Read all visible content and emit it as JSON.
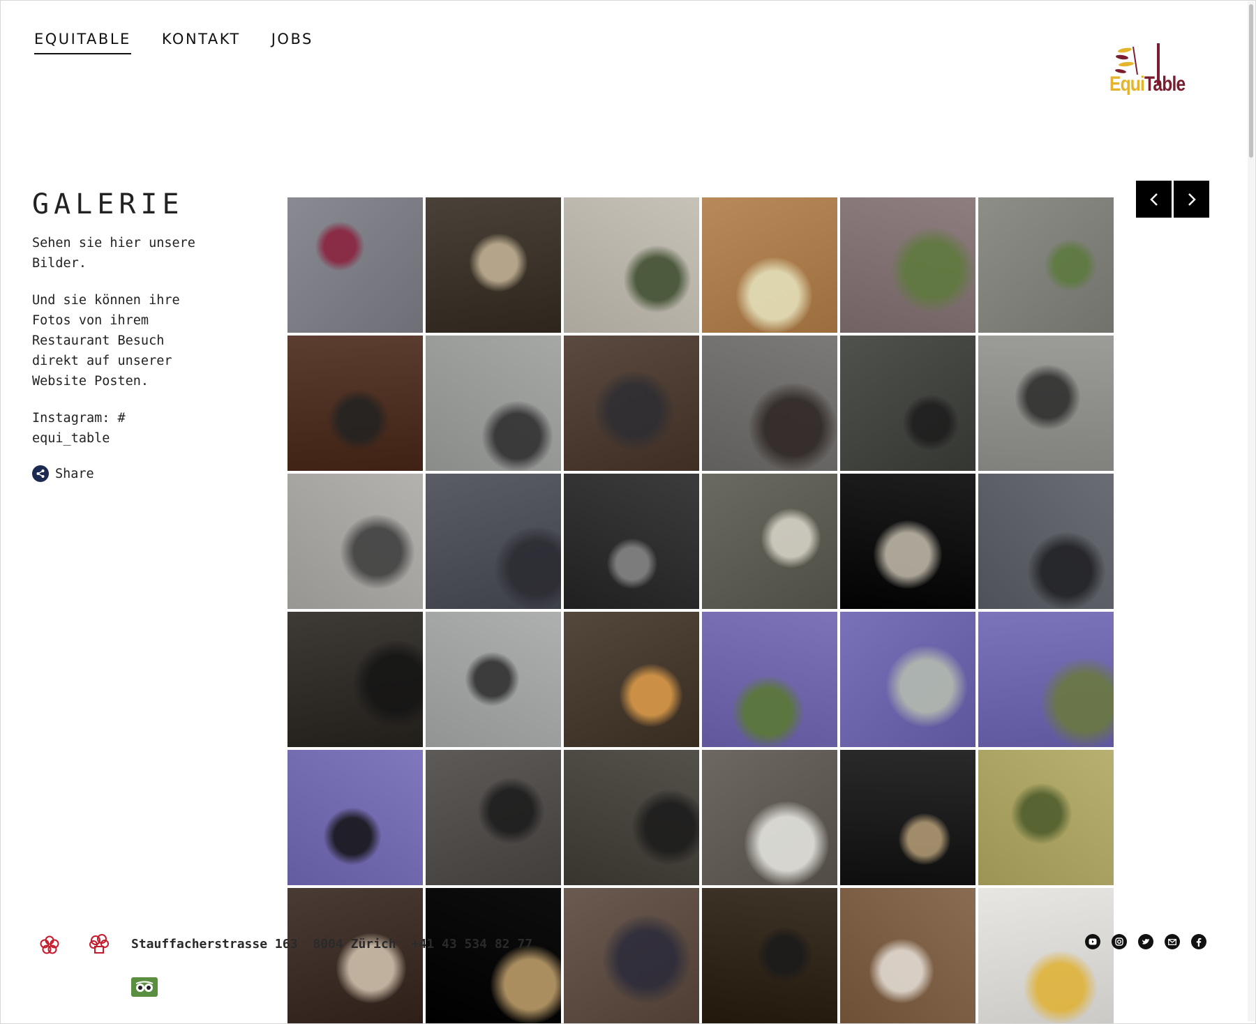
{
  "nav": {
    "items": [
      {
        "label": "EQUITABLE",
        "active": true
      },
      {
        "label": "KONTAKT",
        "active": false
      },
      {
        "label": "JOBS",
        "active": false
      }
    ]
  },
  "logo": {
    "part1": "Equi",
    "part2": "Table"
  },
  "galerie": {
    "title": "GALERIE",
    "intro": "Sehen sie hier unsere\nBilder.",
    "body": "Und sie können ihre\nFotos von ihrem\nRestaurant Besuch\ndirekt auf unserer\nWebsite Posten.",
    "instagram": "Instagram: #\nequi_table",
    "share_label": "Share"
  },
  "gallery": {
    "photos": [
      {
        "name": "photo-gault-millau-award",
        "bg": "#8a8a92",
        "accent": "#8b1d3a"
      },
      {
        "name": "photo-dining-room",
        "bg": "#4a4238",
        "accent": "#c9b89a"
      },
      {
        "name": "photo-dish-on-paper",
        "bg": "#c7c2b8",
        "accent": "#3a4a2a"
      },
      {
        "name": "photo-plate-on-wood",
        "bg": "#b88a5a",
        "accent": "#e8e6c0"
      },
      {
        "name": "photo-terrace-facade",
        "bg": "#8e7e80",
        "accent": "#5d7a3a"
      },
      {
        "name": "photo-entrance-plants",
        "bg": "#8d8e88",
        "accent": "#5c7a3c"
      },
      {
        "name": "photo-couple-at-bar",
        "bg": "#5c3e30",
        "accent": "#222"
      },
      {
        "name": "photo-couple-street",
        "bg": "#a6a8a6",
        "accent": "#2a2a2a"
      },
      {
        "name": "photo-chef-cutting",
        "bg": "#5a4a40",
        "accent": "#2d2d33"
      },
      {
        "name": "photo-chef-woman-kitchen",
        "bg": "#7c7a78",
        "accent": "#2c2422"
      },
      {
        "name": "photo-smiling-chef",
        "bg": "#50524e",
        "accent": "#1c1c1c"
      },
      {
        "name": "photo-chefs-in-kitchen",
        "bg": "#9c9c98",
        "accent": "#2a2a2a"
      },
      {
        "name": "photo-sneakers-apron",
        "bg": "#b4b2ae",
        "accent": "#3a3a3a"
      },
      {
        "name": "photo-chefs-group-closeup",
        "bg": "#5a5c66",
        "accent": "#2a2a30"
      },
      {
        "name": "photo-kitchen-line",
        "bg": "#3c3c3c",
        "accent": "#8a8a8a"
      },
      {
        "name": "photo-plating-siphon",
        "bg": "#6a6a60",
        "accent": "#dcd8cc"
      },
      {
        "name": "photo-dish-dark-plate",
        "bg": "#1e1e1e",
        "accent": "#c8c0b0"
      },
      {
        "name": "photo-team-portrait",
        "bg": "#6a6e74",
        "accent": "#1e1e22"
      },
      {
        "name": "photo-chef-hair-bun",
        "bg": "#3e3a36",
        "accent": "#141414"
      },
      {
        "name": "photo-chef-and-guest",
        "bg": "#aeb0b0",
        "accent": "#2a2a2a"
      },
      {
        "name": "photo-grill-fire",
        "bg": "#54483c",
        "accent": "#e3a04a"
      },
      {
        "name": "photo-dish-grass-purple",
        "bg": "#7d73b8",
        "accent": "#5a7a2e"
      },
      {
        "name": "photo-bowl-purple",
        "bg": "#7a72b8",
        "accent": "#b8c0b0"
      },
      {
        "name": "photo-green-soup-purple",
        "bg": "#7c74ba",
        "accent": "#6a7a3a"
      },
      {
        "name": "photo-black-plate-purple",
        "bg": "#8078bc",
        "accent": "#121212"
      },
      {
        "name": "photo-chef-cloche",
        "bg": "#5e5a58",
        "accent": "#1a1a1a"
      },
      {
        "name": "photo-service-team",
        "bg": "#54504a",
        "accent": "#1a1a1a"
      },
      {
        "name": "photo-white-dessert-stone",
        "bg": "#6e6862",
        "accent": "#ecece6"
      },
      {
        "name": "photo-smoke-dish",
        "bg": "#2a2a2a",
        "accent": "#b8a078"
      },
      {
        "name": "photo-herb-salad-plate",
        "bg": "#b8b070",
        "accent": "#4a5a2a"
      },
      {
        "name": "photo-chefs-plating",
        "bg": "#4a3c34",
        "accent": "#d8c8b4"
      },
      {
        "name": "photo-bowl-dark",
        "bg": "#0e0e0e",
        "accent": "#c8a670"
      },
      {
        "name": "photo-chef-apron",
        "bg": "#6a5a50",
        "accent": "#2a2a3a"
      },
      {
        "name": "photo-plate-dark-table",
        "bg": "#3e3428",
        "accent": "#1a1a1a"
      },
      {
        "name": "photo-coffee-beans",
        "bg": "#8a6c52",
        "accent": "#e8e2da"
      },
      {
        "name": "photo-white-bowl-dish",
        "bg": "#e8e6e2",
        "accent": "#e0b030"
      }
    ]
  },
  "arrows": {
    "prev": "‹",
    "next": "›"
  },
  "footer": {
    "address_parts": [
      "Stauffacherstrasse 163",
      "8004 Zürich",
      "+41 43 534 82 77"
    ],
    "award_icons": [
      "michelin-flower-icon",
      "gault-millau-toque-icon"
    ],
    "tripadvisor": "tripadvisor-icon",
    "social": [
      "youtube-icon",
      "instagram-icon",
      "twitter-icon",
      "mail-icon",
      "facebook-icon"
    ]
  },
  "colors": {
    "logo_gold": "#e3b42c",
    "logo_wine": "#7a1d2e",
    "share_blue": "#1c2a52",
    "award_red": "#c41a2c"
  }
}
